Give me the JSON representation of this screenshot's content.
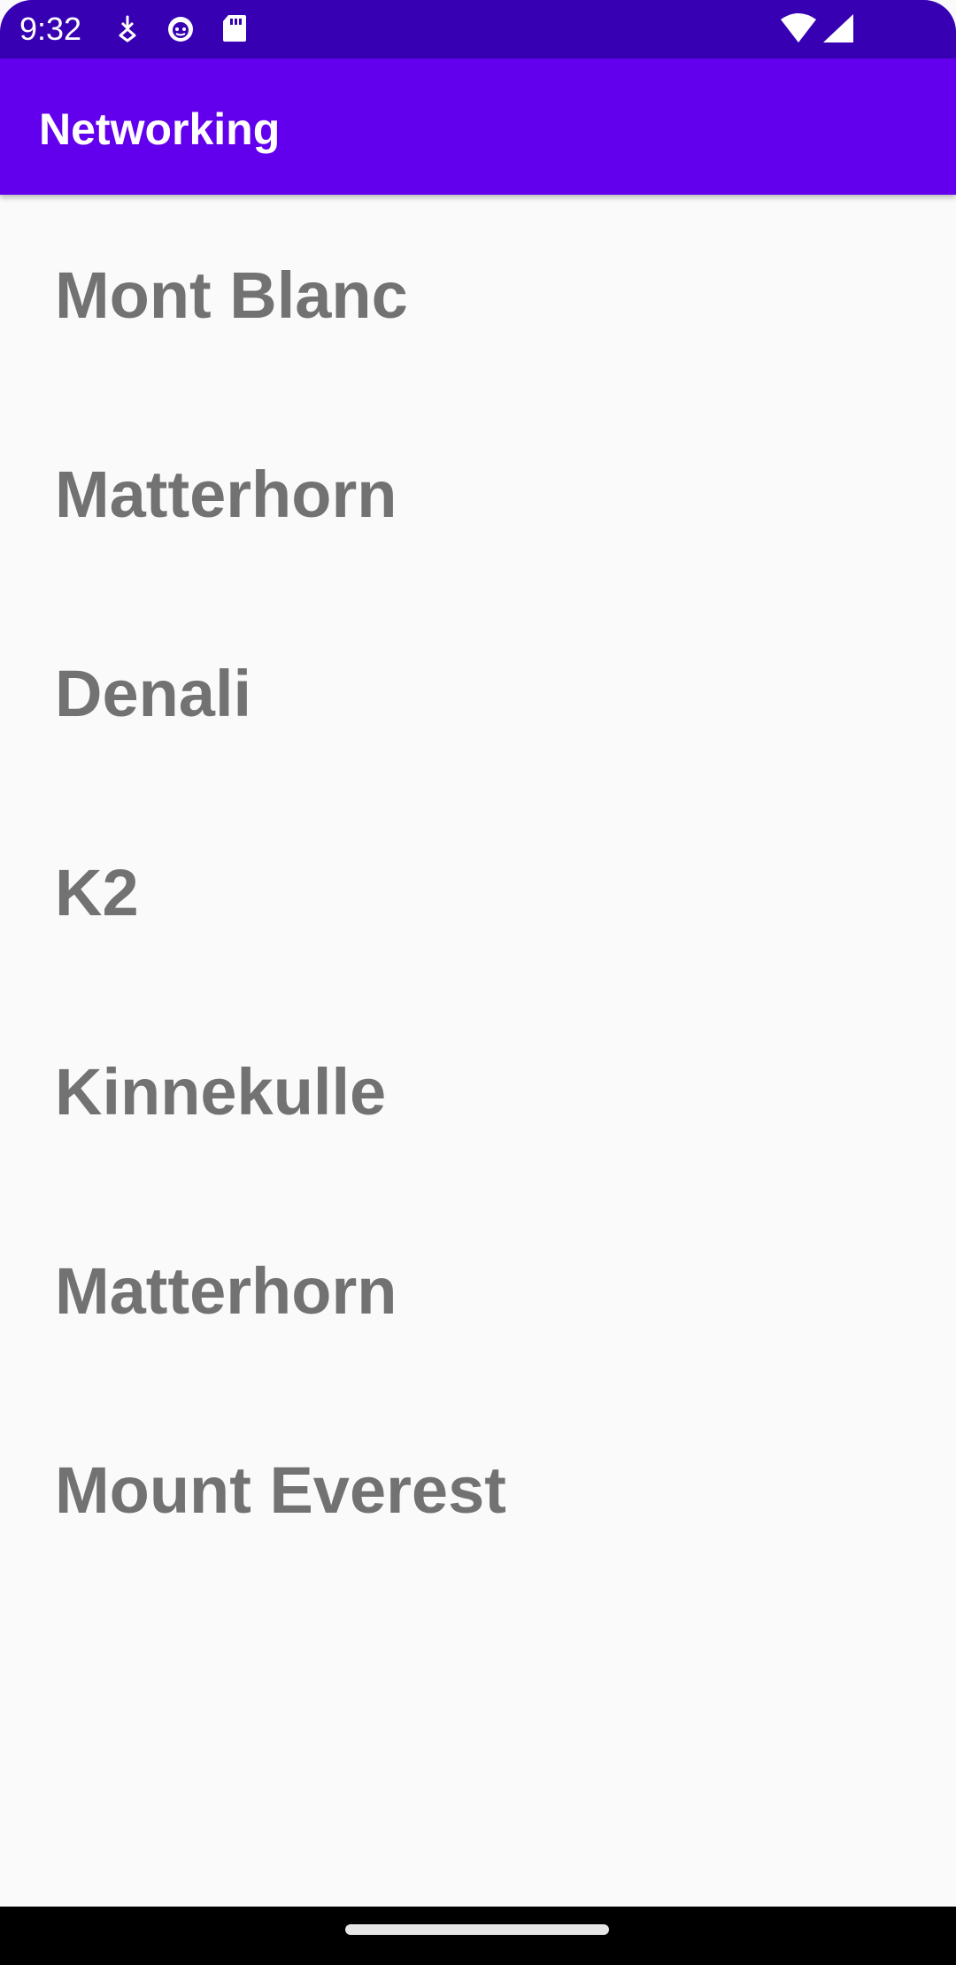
{
  "status_bar": {
    "time": "9:32",
    "icons": [
      "download-notification-icon",
      "android-debug-icon",
      "sd-card-icon",
      "wifi-icon",
      "cell-signal-icon"
    ],
    "background": "#3700b3"
  },
  "app_bar": {
    "title": "Networking",
    "background": "#6200ee"
  },
  "list": {
    "items": [
      {
        "label": "Mont Blanc"
      },
      {
        "label": "Matterhorn"
      },
      {
        "label": "Denali"
      },
      {
        "label": "K2"
      },
      {
        "label": "Kinnekulle"
      },
      {
        "label": "Matterhorn"
      },
      {
        "label": "Mount Everest"
      }
    ],
    "text_color": "#727272"
  }
}
